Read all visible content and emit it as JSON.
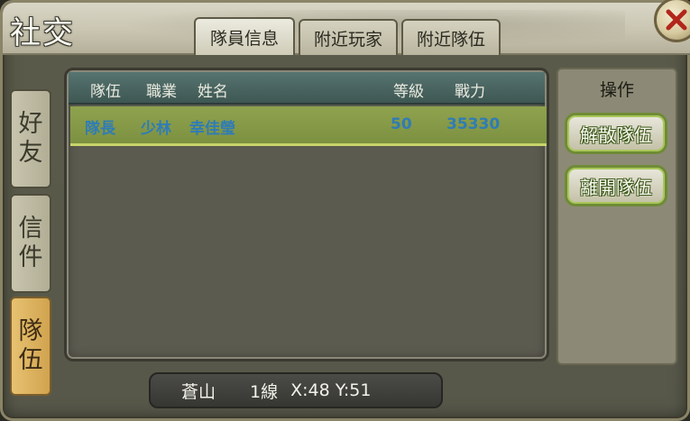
{
  "window": {
    "title": "社交"
  },
  "top_tabs": [
    {
      "label": "隊員信息",
      "active": true
    },
    {
      "label": "附近玩家",
      "active": false
    },
    {
      "label": "附近隊伍",
      "active": false
    }
  ],
  "side_tabs": [
    {
      "label_top": "好",
      "label_bottom": "友",
      "active": false
    },
    {
      "label_top": "信",
      "label_bottom": "件",
      "active": false
    },
    {
      "label_top": "隊",
      "label_bottom": "伍",
      "active": true
    }
  ],
  "member_list": {
    "columns": [
      "隊伍",
      "職業",
      "姓名",
      "等級",
      "戰力"
    ],
    "rows": [
      {
        "team": "隊長",
        "class": "少林",
        "name": "幸佳瑩",
        "level": "50",
        "power": "35330"
      }
    ]
  },
  "operations": {
    "title": "操作",
    "disband_label": "解散隊伍",
    "leave_label": "離開隊伍"
  },
  "location": {
    "zone": "蒼山",
    "line": "1線",
    "coords": "X:48 Y:51"
  },
  "colors": {
    "selected_row": "#869a48",
    "row_text": "#2f7cb6",
    "header_bg": "#4a6561",
    "active_side_tab": "#dcb25f"
  },
  "icons": {
    "close": "close-icon"
  }
}
